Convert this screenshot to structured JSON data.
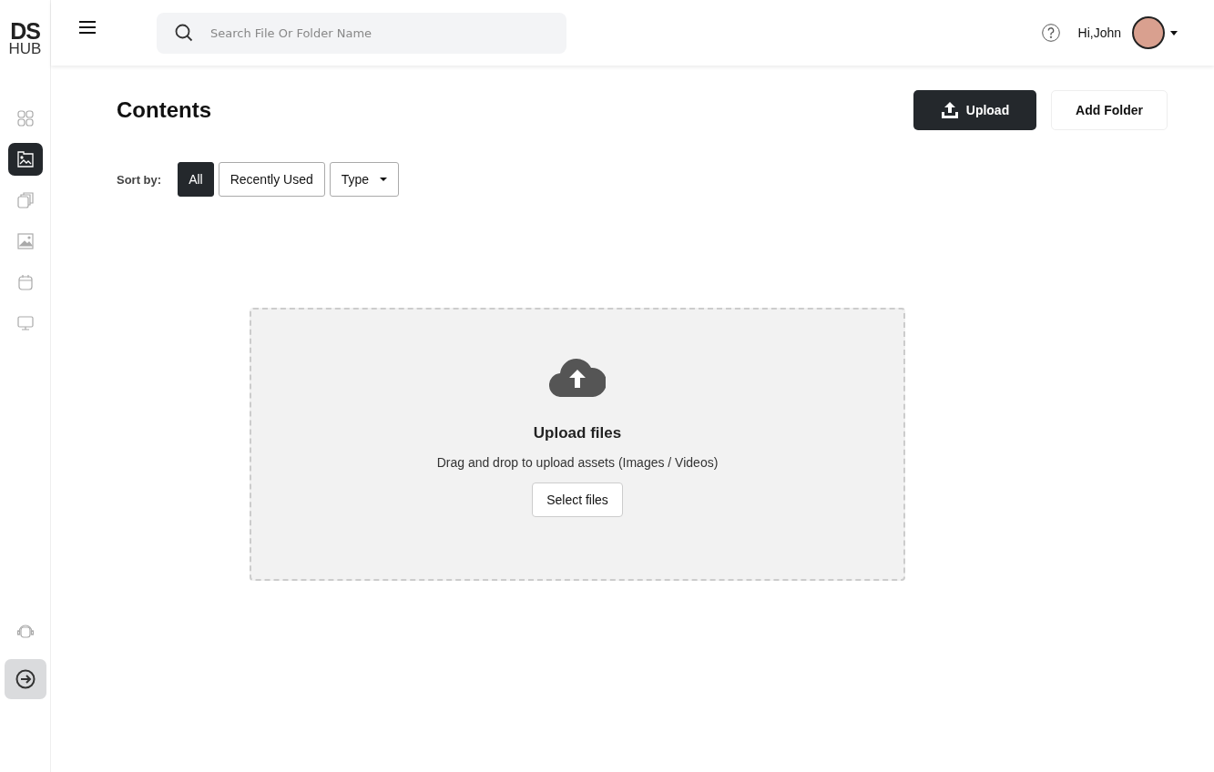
{
  "logo": {
    "line_1": "DS",
    "line_2": "HUB"
  },
  "sidebar": {
    "items": [
      {
        "kind": "grid",
        "selected": false
      },
      {
        "kind": "gallery",
        "selected": true
      },
      {
        "kind": "copies",
        "selected": false
      },
      {
        "kind": "image",
        "selected": false
      },
      {
        "kind": "calendar",
        "selected": false
      },
      {
        "kind": "monitor",
        "selected": false
      }
    ],
    "bottom_items": [
      {
        "kind": "support",
        "selected": false
      },
      {
        "kind": "logout",
        "selected": true
      }
    ]
  },
  "search": {
    "placeholder": "Search File Or Folder Name"
  },
  "user": {
    "greeting": "Hi,John"
  },
  "page": {
    "title": "Contents",
    "buttons": [
      {
        "label": "Upload",
        "kind": "primary"
      },
      {
        "label": "Add Folder",
        "kind": "secondary"
      }
    ]
  },
  "sort": {
    "label": "Sort by:",
    "options": [
      {
        "label": "All",
        "selected": true
      },
      {
        "label": "Recently Used",
        "selected": false
      }
    ],
    "dropdown": "Type"
  },
  "dropzone": {
    "title": "Upload files",
    "subtitle": "Drag and drop to upload assets (Images / Videos)",
    "button": "Select files"
  }
}
